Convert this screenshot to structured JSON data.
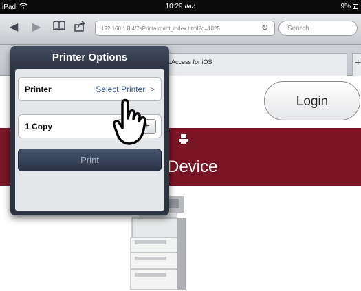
{
  "status_bar": {
    "device": "iPad",
    "time": "10:29 ሀፀሪ",
    "battery": "9%"
  },
  "toolbar": {
    "url": "192.168.1.8:4/7sPrintairprint_index.html?o=1025",
    "search_placeholder": "Search"
  },
  "tab": {
    "title": "pAccess for iOS"
  },
  "popover": {
    "title": "Printer Options",
    "printer_label": "Printer",
    "printer_value": "Select Printer",
    "copies_label": "1 Copy",
    "minus": "−",
    "plus": "+",
    "print_label": "Print"
  },
  "page": {
    "login_label": "Login",
    "banner_title": "Device"
  },
  "colors": {
    "banner": "#7a1525",
    "popover": "#2c3442",
    "print_button": "#3a4559",
    "link_text": "#2c4f85"
  }
}
